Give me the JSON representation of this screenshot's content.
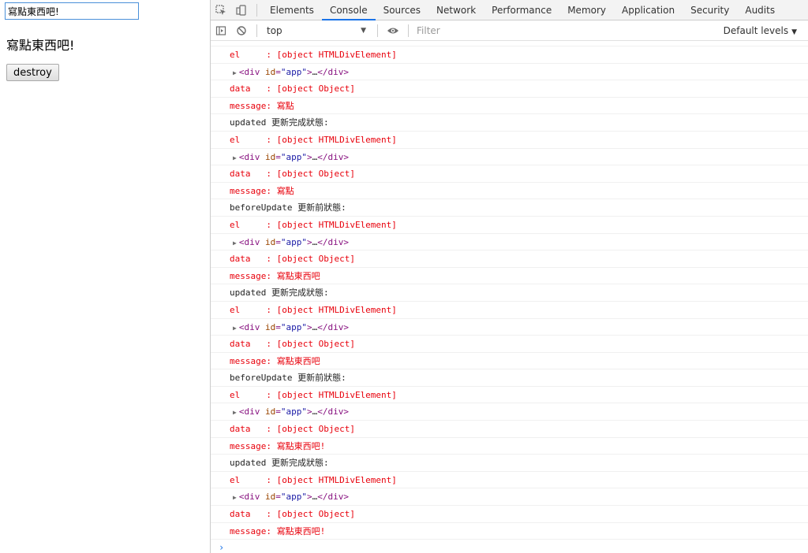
{
  "page": {
    "input_value": "寫點東西吧!",
    "text": "寫點東西吧!",
    "button_label": "destroy"
  },
  "devtools": {
    "tabs": [
      "Elements",
      "Console",
      "Sources",
      "Network",
      "Performance",
      "Memory",
      "Application",
      "Security",
      "Audits"
    ],
    "active_tab": "Console",
    "context": "top",
    "filter_placeholder": "Filter",
    "levels_label": "Default levels",
    "prompt_symbol": "›",
    "node_line": {
      "open": "<div ",
      "attr": "id",
      "eq": "=",
      "value": "\"app\"",
      "close": ">",
      "ellipsis": "…",
      "end": "</div>"
    }
  },
  "console": {
    "lines": [
      {
        "kind": "red",
        "text": "el     : [object HTMLDivElement]"
      },
      {
        "kind": "node"
      },
      {
        "kind": "red",
        "text": "data   : [object Object]"
      },
      {
        "kind": "red",
        "text": "message: 寫點"
      },
      {
        "kind": "black",
        "text": "updated 更新完成狀態:"
      },
      {
        "kind": "red",
        "text": "el     : [object HTMLDivElement]"
      },
      {
        "kind": "node"
      },
      {
        "kind": "red",
        "text": "data   : [object Object]"
      },
      {
        "kind": "red",
        "text": "message: 寫點"
      },
      {
        "kind": "black",
        "text": "beforeUpdate 更新前狀態:"
      },
      {
        "kind": "red",
        "text": "el     : [object HTMLDivElement]"
      },
      {
        "kind": "node"
      },
      {
        "kind": "red",
        "text": "data   : [object Object]"
      },
      {
        "kind": "red",
        "text": "message: 寫點東西吧"
      },
      {
        "kind": "black",
        "text": "updated 更新完成狀態:"
      },
      {
        "kind": "red",
        "text": "el     : [object HTMLDivElement]"
      },
      {
        "kind": "node"
      },
      {
        "kind": "red",
        "text": "data   : [object Object]"
      },
      {
        "kind": "red",
        "text": "message: 寫點東西吧"
      },
      {
        "kind": "black",
        "text": "beforeUpdate 更新前狀態:"
      },
      {
        "kind": "red",
        "text": "el     : [object HTMLDivElement]"
      },
      {
        "kind": "node"
      },
      {
        "kind": "red",
        "text": "data   : [object Object]"
      },
      {
        "kind": "red",
        "text": "message: 寫點東西吧!"
      },
      {
        "kind": "black",
        "text": "updated 更新完成狀態:"
      },
      {
        "kind": "red",
        "text": "el     : [object HTMLDivElement]"
      },
      {
        "kind": "node"
      },
      {
        "kind": "red",
        "text": "data   : [object Object]"
      },
      {
        "kind": "red",
        "text": "message: 寫點東西吧!"
      }
    ]
  },
  "colors": {
    "error_red": "#e8000b",
    "accent_blue": "#1a73e8"
  }
}
